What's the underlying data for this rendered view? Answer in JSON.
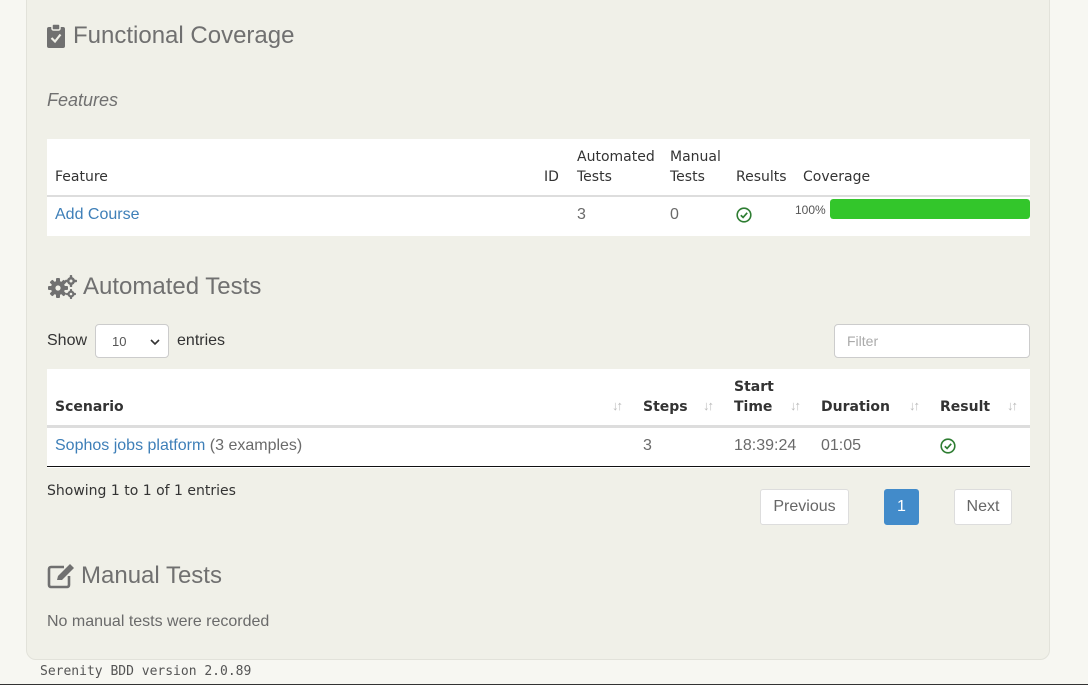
{
  "functional": {
    "title": "Functional Coverage",
    "icon": "clipboard-check-icon",
    "subtitle": "Features",
    "columns": {
      "feature": "Feature",
      "id": "ID",
      "automated_1": "Automated",
      "automated_2": "Tests",
      "manual_1": "Manual",
      "manual_2": "Tests",
      "results": "Results",
      "coverage": "Coverage"
    },
    "rows": [
      {
        "feature": "Add Course",
        "id": "",
        "automated": "3",
        "manual": "0",
        "result": "passed",
        "coverage_label": "100%",
        "coverage_fraction": 1.0
      }
    ]
  },
  "automated": {
    "title": "Automated Tests",
    "icon": "cogs-icon",
    "show_label": "Show",
    "entries_label": "entries",
    "page_size": "10",
    "filter_placeholder": "Filter",
    "columns": {
      "scenario": "Scenario",
      "steps": "Steps",
      "start_1": "Start",
      "start_2": "Time",
      "duration": "Duration",
      "result": "Result"
    },
    "rows": [
      {
        "scenario": "Sophos jobs platform",
        "examples": "(3 examples)",
        "steps": "3",
        "start_time": "18:39:24",
        "duration": "01:05",
        "result": "passed"
      }
    ],
    "info": "Showing 1 to 1 of 1 entries",
    "pagination": {
      "previous": "Previous",
      "current": "1",
      "next": "Next"
    }
  },
  "manual": {
    "title": "Manual Tests",
    "icon": "edit-icon",
    "empty_text": "No manual tests were recorded"
  },
  "footer": "Serenity BDD version 2.0.89",
  "colors": {
    "link": "#3e7fb8",
    "pass": "#2e7d32",
    "bar": "#33c62b",
    "active_page": "#428bca"
  }
}
